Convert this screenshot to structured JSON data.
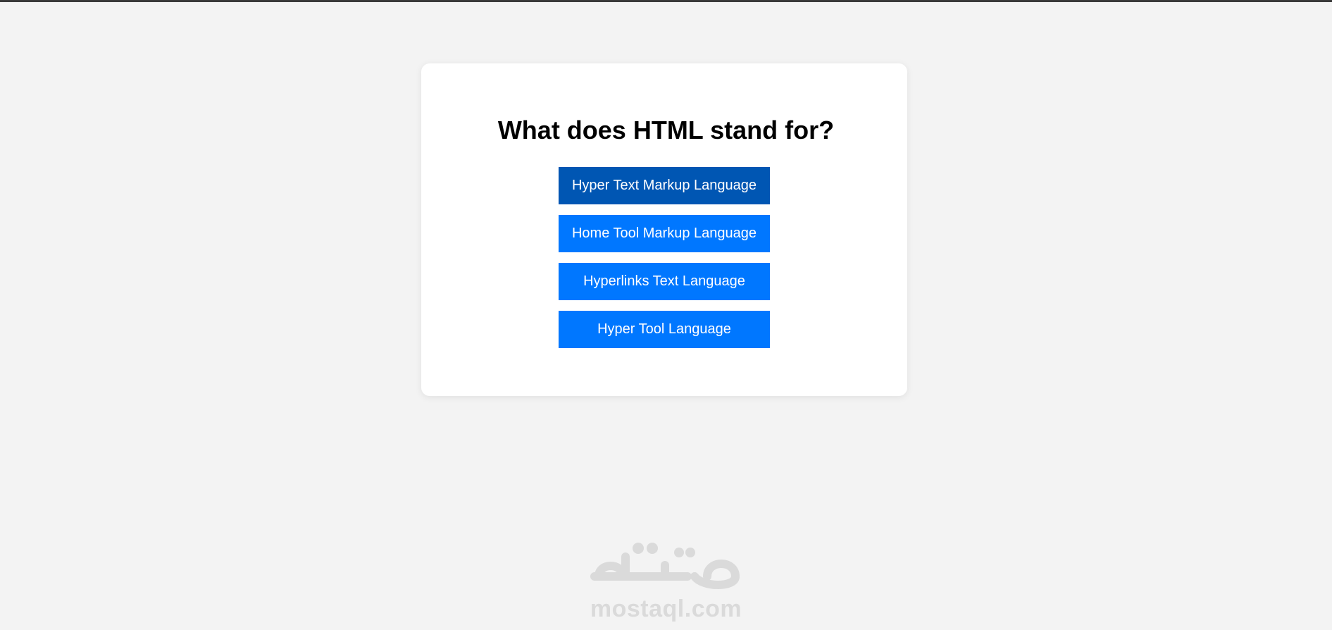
{
  "quiz": {
    "question": "What does HTML stand for?",
    "answers": [
      {
        "label": "Hyper Text Markup Language",
        "selected": true
      },
      {
        "label": "Home Tool Markup Language",
        "selected": false
      },
      {
        "label": "Hyperlinks Text Language",
        "selected": false
      },
      {
        "label": "Hyper Tool Language",
        "selected": false
      }
    ]
  },
  "watermark": {
    "text": "mostaql.com"
  },
  "colors": {
    "page_background": "#f3f3f3",
    "card_background": "#ffffff",
    "button": "#0077ff",
    "button_selected": "#0056b3",
    "watermark": "#dadada"
  }
}
